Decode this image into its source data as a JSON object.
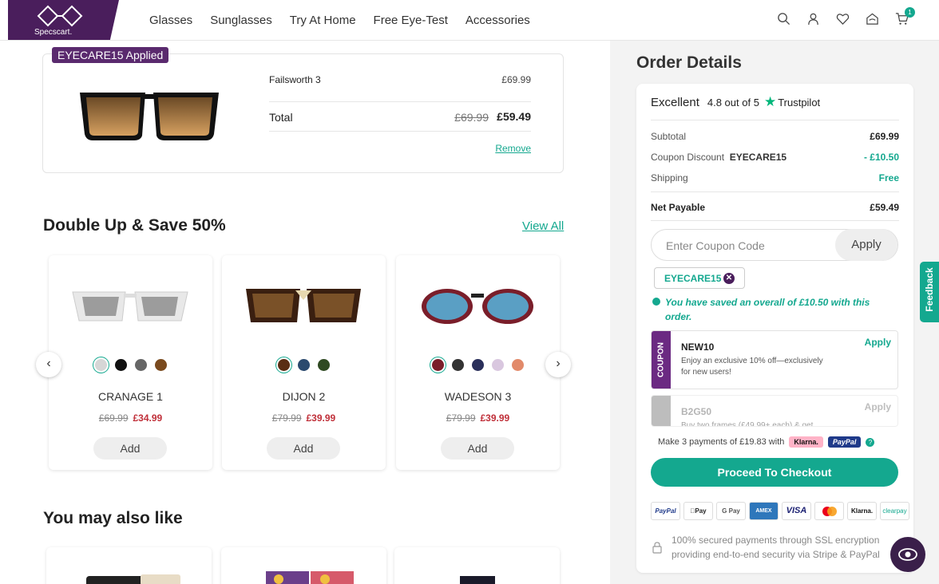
{
  "header": {
    "brand": "Specscart.",
    "nav": [
      "Glasses",
      "Sunglasses",
      "Try At Home",
      "Free Eye-Test",
      "Accessories"
    ],
    "cart_count": "1"
  },
  "cart_item": {
    "applied_tag": "EYECARE15 Applied",
    "name": "Failsworth 3",
    "price": "£69.99",
    "total_label": "Total",
    "total_old": "£69.99",
    "total_new": "£59.49",
    "remove_label": "Remove"
  },
  "double_up": {
    "title": "Double Up & Save 50%",
    "view_all": "View All",
    "products": [
      {
        "name": "CRANAGE 1",
        "old_price": "£69.99",
        "new_price": "£34.99",
        "add": "Add"
      },
      {
        "name": "DIJON 2",
        "old_price": "£79.99",
        "new_price": "£39.99",
        "add": "Add"
      },
      {
        "name": "WADESON 3",
        "old_price": "£79.99",
        "new_price": "£39.99",
        "add": "Add"
      }
    ]
  },
  "also_like": {
    "title": "You may also like"
  },
  "order": {
    "title": "Order Details",
    "trustpilot": {
      "label": "Excellent",
      "rating": "4.8 out of 5",
      "brand": "Trustpilot"
    },
    "subtotal_label": "Subtotal",
    "subtotal": "£69.99",
    "discount_label": "Coupon Discount",
    "discount_code": "EYECARE15",
    "discount": "- £10.50",
    "shipping_label": "Shipping",
    "shipping": "Free",
    "net_label": "Net Payable",
    "net": "£59.49",
    "coupon_placeholder": "Enter Coupon Code",
    "apply_label": "Apply",
    "applied_chip": "EYECARE15",
    "saved_msg": "You have saved an overall of £10.50 with this order.",
    "coupons": [
      {
        "side": "COUPON",
        "code": "NEW10",
        "desc": "Enjoy an exclusive 10% off—exclusively for new users!",
        "apply": "Apply"
      },
      {
        "side": "COUPON",
        "code": "B2G50",
        "desc": "Buy two frames (£49.99+ each) & get",
        "apply": "Apply"
      }
    ],
    "klarna_text": "Make 3 payments of £19.83 with",
    "klarna": "Klarna.",
    "paypal": "PayPal",
    "checkout_label": "Proceed To Checkout",
    "payments": [
      "PayPal",
      "Pay",
      "G Pay",
      "AMEX",
      "VISA",
      "",
      "Klarna.",
      "clearpay"
    ],
    "secure_text": "100% secured payments through SSL encryption providing end-to-end security via Stripe & PayPal"
  },
  "feedback_label": "Feedback",
  "colors": {
    "brand": "#4a1e5c",
    "accent": "#14a88f",
    "sale": "#c0303a"
  }
}
